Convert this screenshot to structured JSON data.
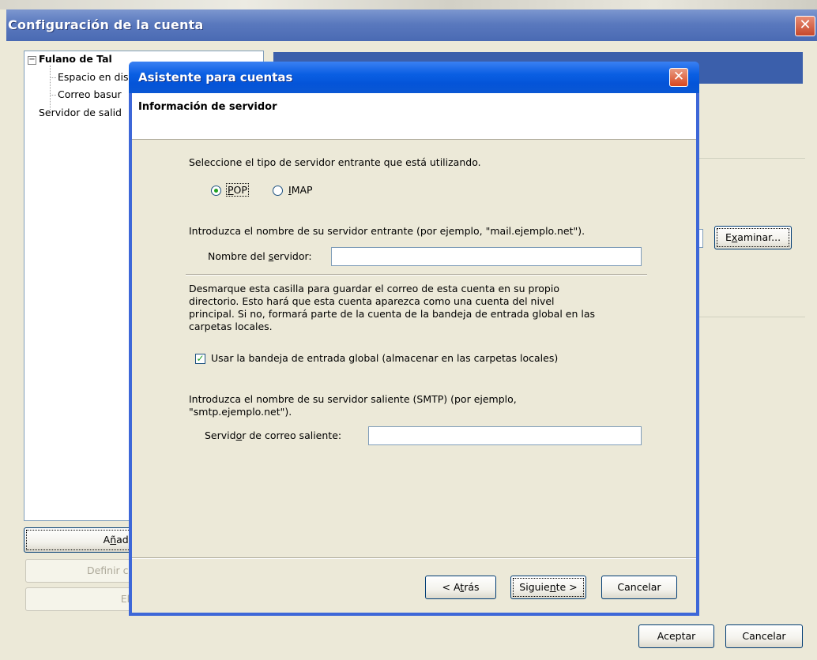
{
  "outer_window": {
    "title": "Configuración de la cuenta",
    "tree": {
      "account": "Fulano de Tal",
      "child_1": "Espacio en dis",
      "child_2": "Correo basur",
      "smtp_item": "Servidor de salid"
    },
    "buttons": {
      "add_prefix": "A",
      "add_mnemonic": "ñ",
      "add_suffix": "adir",
      "set_default": "Definir como",
      "remove": "Elimin",
      "browse_prefix": "E",
      "browse_mnemonic": "x",
      "browse_suffix": "aminar...",
      "accept": "Aceptar",
      "cancel": "Cancelar"
    }
  },
  "dialog": {
    "title": "Asistente para cuentas",
    "header": "Información de servidor",
    "server_type_prompt": "Seleccione el tipo de servidor entrante que está utilizando.",
    "radio_pop": {
      "mnemonic": "P",
      "rest": "OP",
      "selected": true
    },
    "radio_imap": {
      "mnemonic": "I",
      "rest": "MAP",
      "selected": false
    },
    "incoming_prompt": "Introduzca el nombre de su servidor entrante (por ejemplo, \"mail.ejemplo.net\").",
    "server_name_label": {
      "before": "Nombre del ",
      "mnemonic": "s",
      "after": "ervidor:"
    },
    "server_name_value": "",
    "global_inbox_desc": [
      "Desmarque esta casilla para guardar el correo de esta cuenta en su propio",
      "directorio. Esto hará que esta cuenta aparezca como una cuenta del nivel",
      "principal. Si no, formará parte de la cuenta de la bandeja de entrada global en las",
      "carpetas locales."
    ],
    "global_inbox_checkbox": {
      "label": "Usar la bandeja de entrada global (almacenar en las carpetas locales)",
      "checked": true
    },
    "smtp_prompt": [
      "Introduzca el nombre de su servidor saliente (SMTP) (por ejemplo,",
      "\"smtp.ejemplo.net\")."
    ],
    "smtp_label": {
      "before": "Servid",
      "mnemonic": "o",
      "after": "r de correo saliente:"
    },
    "smtp_value": "",
    "buttons": {
      "back": {
        "before": "< A",
        "mnemonic": "t",
        "after": "rás"
      },
      "next": {
        "before": "Siguie",
        "mnemonic": "n",
        "after": "te >"
      },
      "cancel": "Cancelar"
    }
  },
  "colors": {
    "dialog_title_bar": "#0a5fe3",
    "outer_title_bar": "#5a79be",
    "check_green": "#21a121"
  }
}
